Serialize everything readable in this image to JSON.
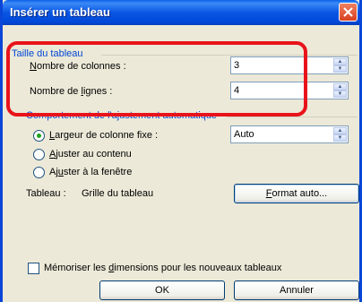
{
  "dialog": {
    "title": "Insérer un tableau"
  },
  "size_section": {
    "title": "Taille du tableau",
    "columns_label_first": "N",
    "columns_label_rest": "ombre de colonnes :",
    "columns_value": "3",
    "rows_label_pre": "Nombre de ",
    "rows_label_u": "l",
    "rows_label_post": "ignes :",
    "rows_value": "4"
  },
  "autofit_section": {
    "title": "Comportement de l'ajustement automatique",
    "fixed_width_pre": "",
    "fixed_width_u": "L",
    "fixed_width_post": "argeur de colonne fixe :",
    "fixed_width_value": "Auto",
    "fit_contents_u": "A",
    "fit_contents_post": "juster au contenu",
    "fit_window_pre": "Aj",
    "fit_window_u": "u",
    "fit_window_post": "ster à la fenêtre"
  },
  "style": {
    "label": "Tableau :",
    "value": "Grille du tableau",
    "format_button_u": "F",
    "format_button_post": "ormat auto..."
  },
  "remember": {
    "pre": "Mémoriser les ",
    "u": "d",
    "post": "imensions pour les nouveaux tableaux"
  },
  "buttons": {
    "ok": "OK",
    "cancel": "Annuler"
  },
  "icons": {
    "close": "close-icon",
    "spin_up": "spin-up-icon",
    "spin_down": "spin-down-icon"
  },
  "colors": {
    "titlebar": "#0a57e4",
    "section_title": "#0046d5",
    "highlight": "#e8131b"
  }
}
